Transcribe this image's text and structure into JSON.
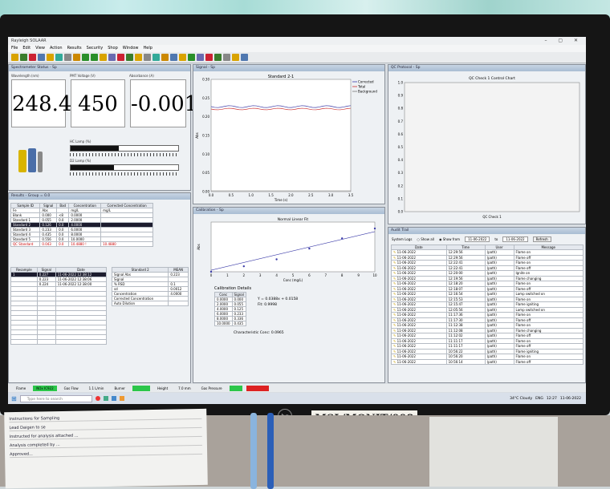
{
  "app": {
    "title": "Rayleigh SOLAAR",
    "menu": [
      "File",
      "Edit",
      "View",
      "Action",
      "Results",
      "Security",
      "Shop",
      "Window",
      "Help"
    ]
  },
  "spectrometer": {
    "header": "Spectrometer Status - Sp",
    "labels": [
      "Wavelength (nm)",
      "PMT Voltage (V)",
      "Absorbance (A)"
    ],
    "values": [
      "248.4",
      "450",
      "-0.001"
    ],
    "lamp_labels": [
      "HC Lamp (%)",
      "D2 Lamp (%)"
    ],
    "lamp_levels": [
      0.45,
      0.4
    ]
  },
  "signal": {
    "header": "Signal - Sp",
    "title": "Standard 2-1",
    "legend": [
      "Corrected",
      "Total",
      "Background"
    ],
    "xlabel": "Time (s)",
    "ylabel": "Abs",
    "yticks": [
      "0.30",
      "0.25",
      "0.20",
      "0.15",
      "0.10",
      "0.05",
      "0.00"
    ],
    "xticks": [
      "0.0",
      "0.5",
      "1.0",
      "1.5",
      "2.0",
      "2.5",
      "3.0",
      "3.5"
    ]
  },
  "qc": {
    "header": "QC Protocol - Sp",
    "title": "QC Check 1 Control Chart",
    "xlabel": "QC Check 1",
    "yticks": [
      "1.0",
      "0.9",
      "0.8",
      "0.7",
      "0.6",
      "0.5",
      "0.4",
      "0.3",
      "0.2",
      "0.1",
      "0.0"
    ]
  },
  "results": {
    "header": "Results - Group = 0.0",
    "columns": [
      "Sample ID",
      "Signal",
      "Bad",
      "Concentration",
      "Corrected Concentration"
    ],
    "units": [
      "Fe",
      "Abs",
      "",
      "mg/L",
      "mg/L"
    ],
    "rows": [
      [
        "Blank",
        "0.000",
        "<8",
        "0.0000",
        ""
      ],
      [
        "Standard 1",
        "0.055",
        "0.0",
        "2.0000",
        ""
      ],
      [
        "Standard 2",
        "0.126",
        "0.0",
        "4.0000",
        ""
      ],
      [
        "Standard 3",
        "0.233",
        "0.0",
        "6.0000",
        ""
      ],
      [
        "Standard 4",
        "0.435",
        "0.0",
        "8.0000",
        ""
      ],
      [
        "Standard 5",
        "0.556",
        "0.0",
        "10.0000",
        ""
      ],
      [
        "QC Standard",
        "0.043",
        "0.0",
        "10.4880 !",
        "10.4880"
      ]
    ],
    "sub_columns": [
      "Resample",
      "Signal",
      "Date"
    ],
    "sub_rows": [
      [
        "1",
        "0.227",
        "11-06-2022 12:38:12"
      ],
      [
        "",
        "0.223",
        "11-06-2022 12:38:06"
      ],
      [
        "",
        "0.224",
        "11-06-2022 12:38:00"
      ]
    ],
    "detail_title": "Standard 2",
    "detail_col": "MEAN",
    "detail_rows": [
      [
        "Signal Abs",
        "0.223"
      ],
      [
        "Signal",
        ""
      ],
      [
        "% RSD",
        "0.1"
      ],
      [
        "sd",
        "0.0012"
      ],
      [
        "Concentration",
        "4.0000"
      ],
      [
        "Corrected Concentration",
        ""
      ],
      [
        "Auto Dilution",
        ""
      ]
    ]
  },
  "calibration": {
    "header": "Calibration - Sp",
    "title": "Normal Linear Fit",
    "xlabel": "Conc (mg/L)",
    "ylabel": "Abs",
    "xticks": [
      "0",
      "1",
      "2",
      "3",
      "4",
      "5",
      "6",
      "7",
      "8",
      "9",
      "10"
    ],
    "details_title": "Calibration Details",
    "table_headers": [
      "Conc",
      "Signal"
    ],
    "table": [
      [
        "0.0000",
        "0.000"
      ],
      [
        "2.0000",
        "0.055"
      ],
      [
        "4.0000",
        "0.125"
      ],
      [
        "6.0000",
        "0.233"
      ],
      [
        "8.0000",
        "0.336"
      ],
      [
        "10.0000",
        "0.435"
      ]
    ],
    "equation": "Y = 0.0388x + 0.0158",
    "fit": "Fit: 0.9998",
    "characteristic": "Characteristic Conc: 0.0965"
  },
  "audit": {
    "header": "Audit Trail",
    "filter_label": "System Logs",
    "options": [
      "Show all",
      "Show from"
    ],
    "date_from": "11-06-2022",
    "date_to": "11-06-2022",
    "refresh": "Refresh",
    "columns": [
      "Date",
      "Time",
      "User",
      "Message"
    ],
    "rows": [
      [
        "11-06-2022",
        "12:29:56",
        "(path)",
        "Flame on"
      ],
      [
        "11-06-2022",
        "12:29:56",
        "(path)",
        "Flame off"
      ],
      [
        "11-06-2022",
        "12:22:41",
        "(path)",
        "Flame on"
      ],
      [
        "11-06-2022",
        "12:22:41",
        "(path)",
        "Flame off"
      ],
      [
        "11-06-2022",
        "12:20:00",
        "(path)",
        "Ignite on"
      ],
      [
        "11-06-2022",
        "12:19:56",
        "(path)",
        "Flame changing"
      ],
      [
        "11-06-2022",
        "12:18:20",
        "(path)",
        "Flame on"
      ],
      [
        "11-06-2022",
        "12:18:07",
        "(path)",
        "Flame off"
      ],
      [
        "11-06-2022",
        "12:16:54",
        "(path)",
        "Lamp switched on"
      ],
      [
        "11-06-2022",
        "12:15:53",
        "(path)",
        "Flame on"
      ],
      [
        "11-06-2022",
        "12:15:47",
        "(path)",
        "Flame igniting"
      ],
      [
        "11-06-2022",
        "12:05:56",
        "(path)",
        "Lamp switched on"
      ],
      [
        "11-06-2022",
        "11:17:36",
        "(path)",
        "Flame on"
      ],
      [
        "11-06-2022",
        "11:17:30",
        "(path)",
        "Flame off"
      ],
      [
        "11-06-2022",
        "11:12:38",
        "(path)",
        "Flame on"
      ],
      [
        "11-06-2022",
        "11:12:08",
        "(path)",
        "Flame changing"
      ],
      [
        "11-06-2022",
        "11:12:02",
        "(path)",
        "Flame off"
      ],
      [
        "11-06-2022",
        "11:11:17",
        "(path)",
        "Flame on"
      ],
      [
        "11-06-2022",
        "11:11:17",
        "(path)",
        "Flame off"
      ],
      [
        "11-06-2022",
        "10:56:22",
        "(path)",
        "Flame igniting"
      ],
      [
        "11-06-2022",
        "10:56:20",
        "(path)",
        "Flame on"
      ],
      [
        "11-06-2022",
        "10:56:14",
        "(path)",
        "Flame off"
      ]
    ]
  },
  "status": {
    "items": [
      "Flame",
      "NOx IC922",
      "Gas Flow",
      "1.1 L/min",
      "Burner",
      "",
      "Height",
      "7.0 mm",
      "Gas Pressure"
    ]
  },
  "taskbar": {
    "search": "Type here to search",
    "weather": "34°C Cloudy",
    "time": "12:27",
    "date": "11-06-2022",
    "lang": "ENG"
  },
  "label_tag": "MSL/MONIT/008",
  "monitor_brand": "hp",
  "paper_lines": [
    "Instructions for Sampling",
    "Lead  Daigen to se",
    "Instructed for analysis attached ...",
    "Analysis completed by ...",
    "Approved..."
  ]
}
